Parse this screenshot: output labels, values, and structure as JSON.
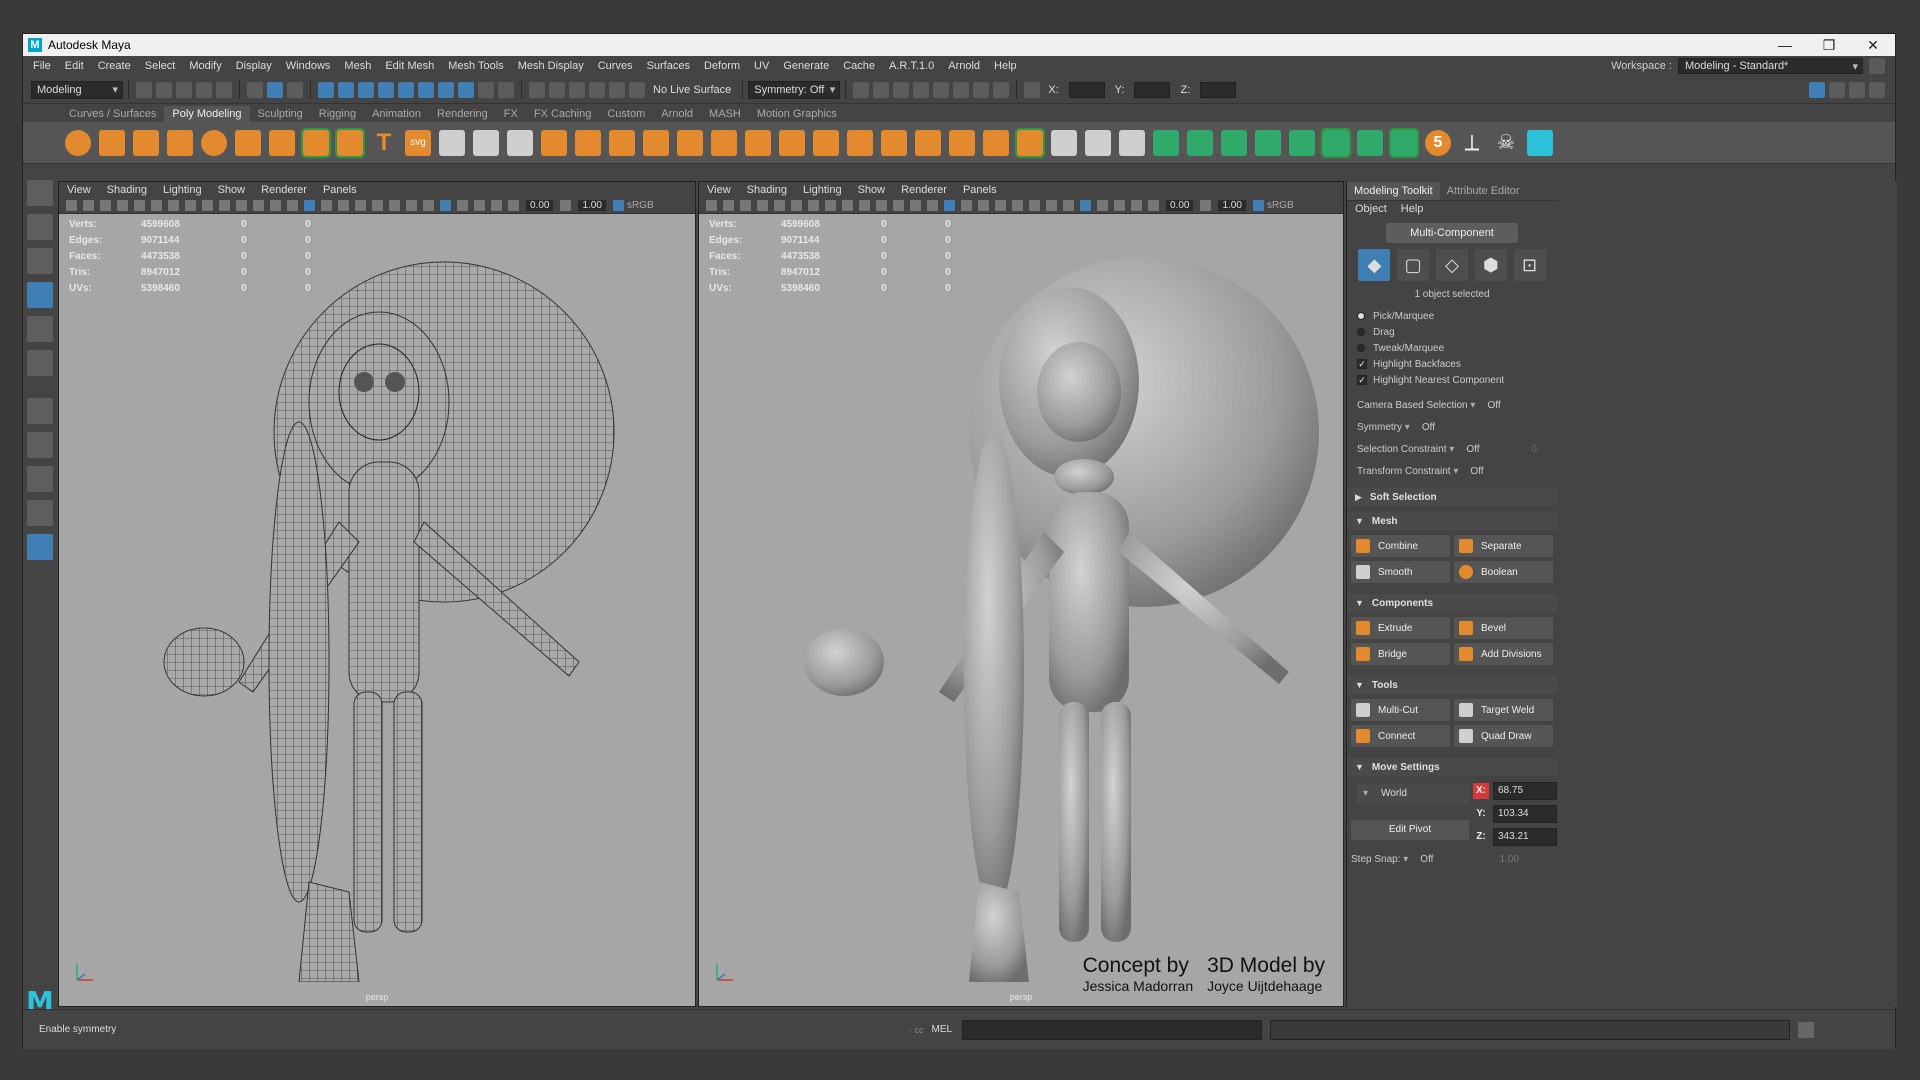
{
  "window": {
    "title": "Autodesk Maya",
    "logo": "M",
    "controls": [
      "—",
      "❐",
      "✕"
    ]
  },
  "menu": {
    "items": [
      "File",
      "Edit",
      "Create",
      "Select",
      "Modify",
      "Display",
      "Windows",
      "Mesh",
      "Edit Mesh",
      "Mesh Tools",
      "Mesh Display",
      "Curves",
      "Surfaces",
      "Deform",
      "UV",
      "Generate",
      "Cache",
      "A.R.T.1.0",
      "Arnold",
      "Help"
    ],
    "workspace_label": "Workspace :",
    "workspace_value": "Modeling - Standard*"
  },
  "statusline": {
    "menuset": "Modeling",
    "live_surface": "No Live Surface",
    "symmetry": "Symmetry: Off",
    "x_label": "X:",
    "y_label": "Y:",
    "z_label": "Z:"
  },
  "shelf": {
    "tabs": [
      "Curves / Surfaces",
      "Poly Modeling",
      "Sculpting",
      "Rigging",
      "Animation",
      "Rendering",
      "FX",
      "FX Caching",
      "Custom",
      "Arnold",
      "MASH",
      "Motion Graphics"
    ],
    "active_tab": "Poly Modeling",
    "text_icon": "T",
    "svg_icon": "svg",
    "number_icon": "5"
  },
  "viewport_left": {
    "menu": [
      "View",
      "Shading",
      "Lighting",
      "Show",
      "Renderer",
      "Panels"
    ],
    "num1": "0.00",
    "num2": "1.00",
    "color_space": "sRGB",
    "hud": [
      {
        "label": "Verts:",
        "v1": "4599608",
        "v2": "0",
        "v3": "0"
      },
      {
        "label": "Edges:",
        "v1": "9071144",
        "v2": "0",
        "v3": "0"
      },
      {
        "label": "Faces:",
        "v1": "4473538",
        "v2": "0",
        "v3": "0"
      },
      {
        "label": "Tris:",
        "v1": "8947012",
        "v2": "0",
        "v3": "0"
      },
      {
        "label": "UVs:",
        "v1": "5398460",
        "v2": "0",
        "v3": "0"
      }
    ],
    "camera": "persp"
  },
  "viewport_right": {
    "menu": [
      "View",
      "Shading",
      "Lighting",
      "Show",
      "Renderer",
      "Panels"
    ],
    "num1": "0.00",
    "num2": "1.00",
    "color_space": "sRGB",
    "hud": [
      {
        "label": "Verts:",
        "v1": "4599608",
        "v2": "0",
        "v3": "0"
      },
      {
        "label": "Edges:",
        "v1": "9071144",
        "v2": "0",
        "v3": "0"
      },
      {
        "label": "Faces:",
        "v1": "4473538",
        "v2": "0",
        "v3": "0"
      },
      {
        "label": "Tris:",
        "v1": "8947012",
        "v2": "0",
        "v3": "0"
      },
      {
        "label": "UVs:",
        "v1": "5398460",
        "v2": "0",
        "v3": "0"
      }
    ],
    "camera": "persp",
    "credit": {
      "concept_title": "Concept by",
      "concept_name": "Jessica Madorran",
      "model_title": "3D Model by",
      "model_name": "Joyce Uijtdehaage"
    }
  },
  "toolkit": {
    "tabs": [
      "Modeling Toolkit",
      "Attribute Editor"
    ],
    "menu": [
      "Object",
      "Help"
    ],
    "multi_component": "Multi-Component",
    "selected_info": "1 object selected",
    "pick_options": [
      {
        "label": "Pick/Marquee",
        "type": "radio",
        "on": true
      },
      {
        "label": "Drag",
        "type": "radio",
        "on": false
      },
      {
        "label": "Tweak/Marquee",
        "type": "radio",
        "on": false
      },
      {
        "label": "Highlight Backfaces",
        "type": "check",
        "on": true
      },
      {
        "label": "Highlight Nearest Component",
        "type": "check",
        "on": true
      }
    ],
    "settings": [
      {
        "label": "Camera Based Selection",
        "value": "Off"
      },
      {
        "label": "Symmetry",
        "value": "Off"
      },
      {
        "label": "Selection Constraint",
        "value": "Off"
      },
      {
        "label": "Transform Constraint",
        "value": "Off"
      }
    ],
    "selection_constraint_extra": "0",
    "soft_selection": "Soft Selection",
    "mesh_section": "Mesh",
    "mesh_buttons": [
      "Combine",
      "Separate",
      "Smooth",
      "Boolean"
    ],
    "components_section": "Components",
    "component_buttons": [
      "Extrude",
      "Bevel",
      "Bridge",
      "Add Divisions"
    ],
    "tools_section": "Tools",
    "tool_buttons": [
      "Multi-Cut",
      "Target Weld",
      "Connect",
      "Quad Draw"
    ],
    "move_section": "Move Settings",
    "space": "World",
    "edit_pivot": "Edit Pivot",
    "x": "68.75",
    "y": "103.34",
    "z": "343.21",
    "step_snap_label": "Step Snap:",
    "step_snap_value": "Off",
    "step_snap_num": "1.00"
  },
  "bottom": {
    "help_line": "Enable symmetry",
    "cmd_type": "MEL",
    "cmd_prefix": "· cc"
  },
  "colors": {
    "accent_blue": "#3f7fb5",
    "shelf_orange": "#e38a2e",
    "shelf_green": "#2faa6a",
    "shelf_cyan": "#2cc2d9",
    "x_red": "#d43a3a",
    "viewport_bg": "#a6a6a6"
  }
}
